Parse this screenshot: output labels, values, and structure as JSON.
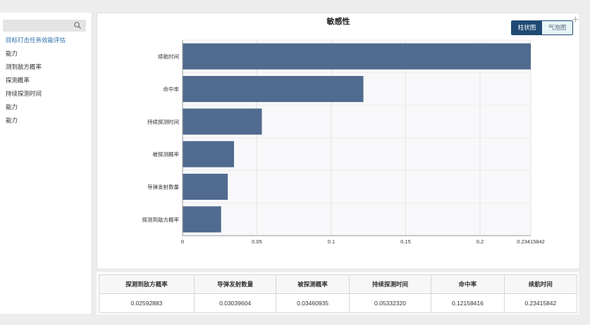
{
  "sidebar": {
    "items": [
      {
        "label": "目标打击任务效能评估",
        "active": true
      },
      {
        "label": "能力"
      },
      {
        "label": "测到敌方概率"
      },
      {
        "label": "探测概率"
      },
      {
        "label": "持续探测时间"
      },
      {
        "label": "能力"
      },
      {
        "label": "能力"
      }
    ]
  },
  "chart": {
    "title": "敏感性",
    "toggle": {
      "bar_label": "柱状图",
      "bubble_label": "气泡图",
      "selected": "柱状图"
    }
  },
  "chart_data": {
    "type": "bar",
    "orientation": "horizontal",
    "title": "敏感性",
    "categories": [
      "续航时间",
      "命中率",
      "持续探测时间",
      "被探测概率",
      "导弹发射数量",
      "探测到敌方概率"
    ],
    "values": [
      0.23415842,
      0.12158416,
      0.0533232,
      0.03460935,
      0.03039604,
      0.02592883
    ],
    "xlim": [
      0,
      0.23415842
    ],
    "xticks": [
      "0",
      "0.05",
      "0.1",
      "0.15",
      "0.2",
      "0.23415842"
    ],
    "bar_color": "#506b8f",
    "grid": true
  },
  "table": {
    "headers": [
      "探测到敌方概率",
      "导弹发射数量",
      "被探测概率",
      "持续探测时间",
      "命中率",
      "续航时间"
    ],
    "values": [
      "0.02592883",
      "0.03039604",
      "0.03460935",
      "0.05332320",
      "0.12158416",
      "0.23415842"
    ]
  }
}
